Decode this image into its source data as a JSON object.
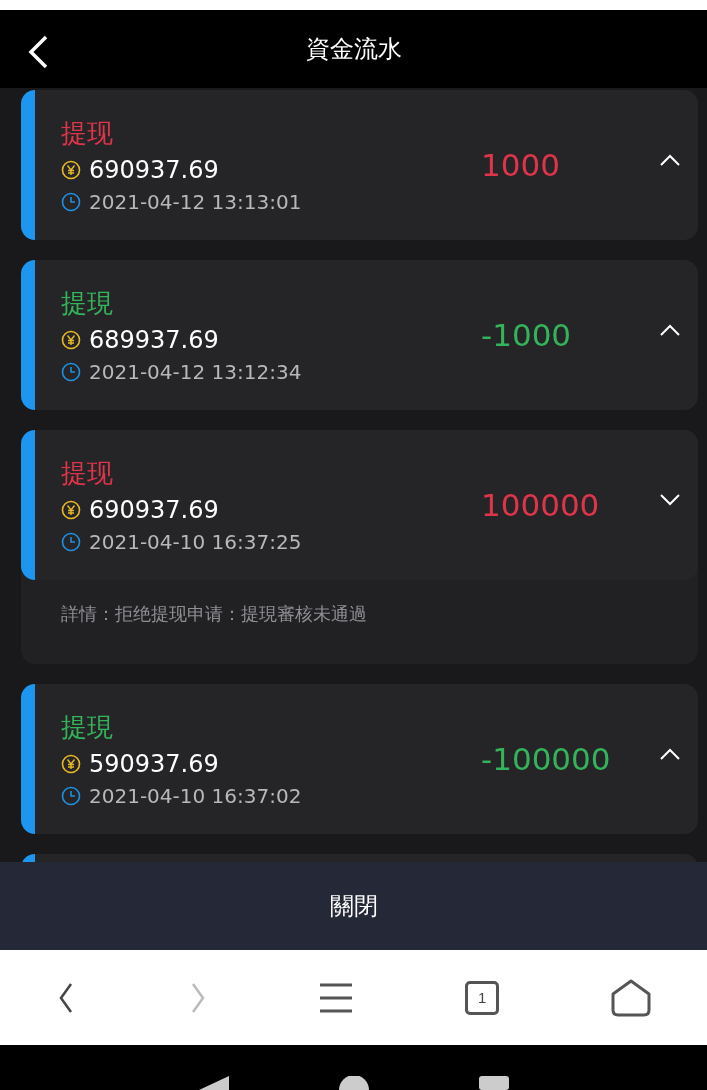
{
  "header": {
    "title": "資金流水"
  },
  "records": [
    {
      "type": "提现",
      "color": "#e0344a",
      "balance": "690937.69",
      "time": "2021-04-12 13:13:01",
      "amount": "1000",
      "expanded": false
    },
    {
      "type": "提現",
      "color": "#34b45a",
      "balance": "689937.69",
      "time": "2021-04-12 13:12:34",
      "amount": "-1000",
      "expanded": false
    },
    {
      "type": "提现",
      "color": "#e0344a",
      "balance": "690937.69",
      "time": "2021-04-10 16:37:25",
      "amount": "100000",
      "expanded": true,
      "detail": "詳情：拒绝提现申请：提現審核未通過"
    },
    {
      "type": "提現",
      "color": "#34b45a",
      "balance": "590937.69",
      "time": "2021-04-10 16:37:02",
      "amount": "-100000",
      "expanded": false
    }
  ],
  "close_button": "關閉",
  "browser_bar": {
    "back_disabled": false,
    "forward_disabled": true,
    "tab_count": "1"
  }
}
